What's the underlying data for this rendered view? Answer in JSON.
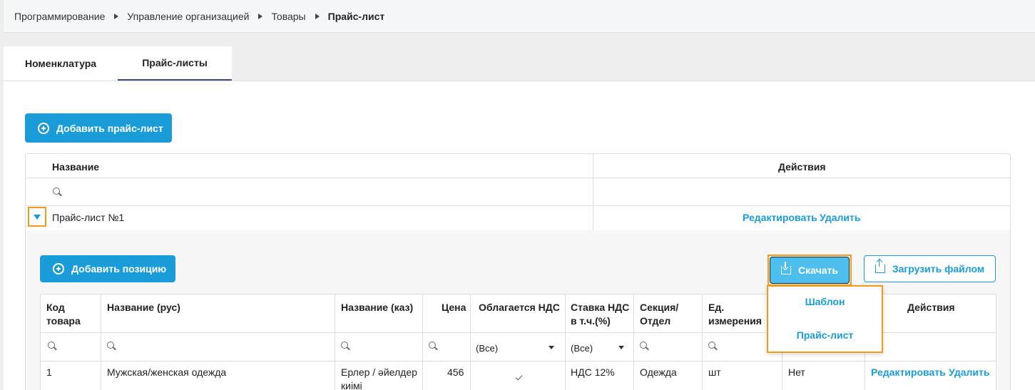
{
  "breadcrumb": [
    "Программирование",
    "Управление организацией",
    "Товары",
    "Прайс-лист"
  ],
  "tabs": [
    "Номенклатура",
    "Прайс-листы"
  ],
  "add_pricelist_label": "Добавить прайс-лист",
  "outer_table": {
    "header_name": "Название",
    "header_actions": "Действия",
    "row_name": "Прайс-лист №1",
    "edit_label": "Редактировать",
    "delete_label": "Удалить"
  },
  "detail": {
    "add_position_label": "Добавить позицию",
    "download_label": "Скачать",
    "upload_label": "Загрузить файлом",
    "columns": [
      "Код товара",
      "Название (рус)",
      "Название (каз)",
      "Цена",
      "Облагается НДС",
      "Ставка НДС в т.ч.(%)",
      "Секция/ Отдел",
      "Ед. измерения",
      "",
      "Действия"
    ],
    "filter_all_1": "(Все)",
    "filter_all_2": "(Все)",
    "row": {
      "code": "1",
      "name_rus": "Мужская/женская одежда",
      "name_kaz": "Ерлер / әйелдер киімі",
      "price": "456",
      "vat_rate": "НДС 12%",
      "section": "Одежда",
      "unit": "шт",
      "extra": "Нет",
      "edit_label": "Редактировать",
      "delete_label": "Удалить"
    }
  },
  "download_menu": [
    "Шаблон",
    "Прайс-лист"
  ],
  "colors": {
    "accent": "#1a9cd8",
    "highlight": "#f29a1a"
  }
}
